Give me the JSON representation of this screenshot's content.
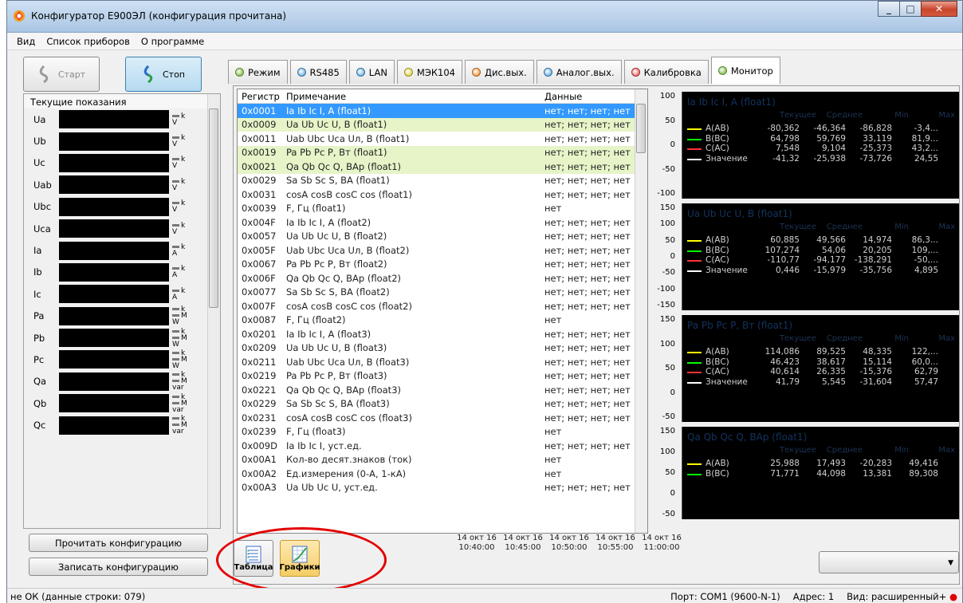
{
  "window": {
    "title": "Конфигуратор Е900ЭЛ (конфигурация прочитана)"
  },
  "menu": [
    "Вид",
    "Список приборов",
    "О программе"
  ],
  "controls": {
    "start_label": "Старт",
    "stop_label": "Стоп"
  },
  "readings": {
    "header": "Текущие показания",
    "rows": [
      {
        "label": "Ua",
        "unit_top": "k",
        "unit_bottom": "V"
      },
      {
        "label": "Ub",
        "unit_top": "k",
        "unit_bottom": "V"
      },
      {
        "label": "Uc",
        "unit_top": "k",
        "unit_bottom": "V"
      },
      {
        "label": "Uab",
        "unit_top": "k",
        "unit_bottom": "V"
      },
      {
        "label": "Ubc",
        "unit_top": "k",
        "unit_bottom": "V"
      },
      {
        "label": "Uca",
        "unit_top": "k",
        "unit_bottom": "V"
      },
      {
        "label": "Ia",
        "unit_top": "k",
        "unit_bottom": "A"
      },
      {
        "label": "Ib",
        "unit_top": "k",
        "unit_bottom": "A"
      },
      {
        "label": "Ic",
        "unit_top": "k",
        "unit_bottom": "A"
      },
      {
        "label": "Pa",
        "unit_top": "k",
        "unit_mid": "M",
        "unit_bottom": "W"
      },
      {
        "label": "Pb",
        "unit_top": "k",
        "unit_mid": "M",
        "unit_bottom": "W"
      },
      {
        "label": "Pc",
        "unit_top": "k",
        "unit_mid": "M",
        "unit_bottom": "W"
      },
      {
        "label": "Qa",
        "unit_top": "k",
        "unit_mid": "M",
        "unit_bottom": "var"
      },
      {
        "label": "Qb",
        "unit_top": "k",
        "unit_mid": "M",
        "unit_bottom": "var"
      },
      {
        "label": "Qc",
        "unit_top": "k",
        "unit_mid": "M",
        "unit_bottom": "var"
      }
    ]
  },
  "buttons": {
    "read_config": "Прочитать конфигурацию",
    "write_config": "Записать конфигурацию"
  },
  "tabs": [
    {
      "label": "Режим",
      "dot": "green"
    },
    {
      "label": "RS485",
      "dot": "blue"
    },
    {
      "label": "LAN",
      "dot": "blue"
    },
    {
      "label": "МЭК104",
      "dot": "yellow"
    },
    {
      "label": "Дис.вых.",
      "dot": "orange"
    },
    {
      "label": "Аналог.вых.",
      "dot": "blue"
    },
    {
      "label": "Калибровка",
      "dot": "red"
    },
    {
      "label": "Монитор",
      "dot": "green",
      "active": true
    }
  ],
  "table": {
    "columns": [
      "Регистр",
      "Примечание",
      "Данные"
    ],
    "rows": [
      {
        "reg": "0x0001",
        "note": "Ia Ib Ic I, A (float1)",
        "data": "нет; нет; нет; нет",
        "state": "sel"
      },
      {
        "reg": "0x0009",
        "note": "Ua Ub Uc U, B (float1)",
        "data": "нет; нет; нет; нет",
        "state": "hl"
      },
      {
        "reg": "0x0011",
        "note": "Uab Ubc Uca Uл, B (float1)",
        "data": "нет; нет; нет; нет",
        "state": ""
      },
      {
        "reg": "0x0019",
        "note": "Pa Pb Pc P, Вт (float1)",
        "data": "нет; нет; нет; нет",
        "state": "hl"
      },
      {
        "reg": "0x0021",
        "note": "Qa Qb Qc Q, BAp (float1)",
        "data": "нет; нет; нет; нет",
        "state": "hl"
      },
      {
        "reg": "0x0029",
        "note": "Sa Sb Sc S, BA (float1)",
        "data": "нет; нет; нет; нет",
        "state": ""
      },
      {
        "reg": "0x0031",
        "note": "cosA cosB cosC cos (float1)",
        "data": "нет; нет; нет; нет",
        "state": ""
      },
      {
        "reg": "0x0039",
        "note": "F, Гц (float1)",
        "data": "нет",
        "state": ""
      },
      {
        "reg": "0x004F",
        "note": "Ia Ib Ic I, A (float2)",
        "data": "нет; нет; нет; нет",
        "state": ""
      },
      {
        "reg": "0x0057",
        "note": "Ua Ub Uc U, B (float2)",
        "data": "нет; нет; нет; нет",
        "state": ""
      },
      {
        "reg": "0x005F",
        "note": "Uab Ubc Uca Uл, B (float2)",
        "data": "нет; нет; нет; нет",
        "state": ""
      },
      {
        "reg": "0x0067",
        "note": "Pa Pb Pc P, Вт (float2)",
        "data": "нет; нет; нет; нет",
        "state": ""
      },
      {
        "reg": "0x006F",
        "note": "Qa Qb Qc Q, BAp (float2)",
        "data": "нет; нет; нет; нет",
        "state": ""
      },
      {
        "reg": "0x0077",
        "note": "Sa Sb Sc S, BA (float2)",
        "data": "нет; нет; нет; нет",
        "state": ""
      },
      {
        "reg": "0x007F",
        "note": "cosA cosB cosC cos (float2)",
        "data": "нет; нет; нет; нет",
        "state": ""
      },
      {
        "reg": "0x0087",
        "note": "F, Гц (float2)",
        "data": "нет",
        "state": ""
      },
      {
        "reg": "0x0201",
        "note": "Ia Ib Ic I, A (float3)",
        "data": "нет; нет; нет; нет",
        "state": ""
      },
      {
        "reg": "0x0209",
        "note": "Ua Ub Uc U, B (float3)",
        "data": "нет; нет; нет; нет",
        "state": ""
      },
      {
        "reg": "0x0211",
        "note": "Uab Ubc Uca Uл, B (float3)",
        "data": "нет; нет; нет; нет",
        "state": ""
      },
      {
        "reg": "0x0219",
        "note": "Pa Pb Pc P, Вт (float3)",
        "data": "нет; нет; нет; нет",
        "state": ""
      },
      {
        "reg": "0x0221",
        "note": "Qa Qb Qc Q, BAp (float3)",
        "data": "нет; нет; нет; нет",
        "state": ""
      },
      {
        "reg": "0x0229",
        "note": "Sa Sb Sc S, BA (float3)",
        "data": "нет; нет; нет; нет",
        "state": ""
      },
      {
        "reg": "0x0231",
        "note": "cosA cosB cosC cos (float3)",
        "data": "нет; нет; нет; нет",
        "state": ""
      },
      {
        "reg": "0x0239",
        "note": "F, Гц (float3)",
        "data": "нет",
        "state": ""
      },
      {
        "reg": "0x009D",
        "note": "Ia Ib Ic I, уст.ед.",
        "data": "нет; нет; нет; нет",
        "state": ""
      },
      {
        "reg": "0x00A1",
        "note": "Кол-во десят.знаков (ток)",
        "data": "нет",
        "state": ""
      },
      {
        "reg": "0x00A2",
        "note": "Ед.измерения (0-A, 1-кA)",
        "data": "нет",
        "state": ""
      },
      {
        "reg": "0x00A3",
        "note": "Ua Ub Uc U, уст.ед.",
        "data": "нет; нет; нет; нет",
        "state": ""
      }
    ]
  },
  "graphs": {
    "column_headers": [
      "Текущее",
      "Среднее",
      "Min",
      "Max"
    ],
    "panels": [
      {
        "title": "Ia Ib Ic I, A (float1)",
        "axis": [
          "100",
          "50",
          "0",
          "-50",
          "-100"
        ],
        "rows": [
          {
            "name": "A(AB)",
            "color": "#ffff00",
            "values": [
              "-80,362",
              "-46,364",
              "-86,828",
              "-3,4..."
            ]
          },
          {
            "name": "B(BC)",
            "color": "#00ff00",
            "values": [
              "64,798",
              "59,769",
              "33,119",
              "81,9..."
            ]
          },
          {
            "name": "C(AC)",
            "color": "#ff3333",
            "values": [
              "7,548",
              "9,104",
              "-25,373",
              "43,2..."
            ]
          },
          {
            "name": "Значение",
            "color": "#ffffff",
            "values": [
              "-41,32",
              "-25,938",
              "-73,726",
              "24,55"
            ]
          }
        ]
      },
      {
        "title": "Ua Ub Uc U, B (float1)",
        "axis": [
          "150",
          "100",
          "50",
          "0",
          "-50",
          "-100",
          "-150"
        ],
        "rows": [
          {
            "name": "A(AB)",
            "color": "#ffff00",
            "values": [
              "60,885",
              "49,566",
              "14,974",
              "86,3..."
            ]
          },
          {
            "name": "B(BC)",
            "color": "#00ff00",
            "values": [
              "107,274",
              "54,06",
              "20,205",
              "109,..."
            ]
          },
          {
            "name": "C(AC)",
            "color": "#ff3333",
            "values": [
              "-110,77",
              "-94,177",
              "-138,291",
              "-50,..."
            ]
          },
          {
            "name": "Значение",
            "color": "#ffffff",
            "values": [
              "0,446",
              "-15,979",
              "-35,756",
              "4,895"
            ]
          }
        ]
      },
      {
        "title": "Pa Pb Pc P, Вт (float1)",
        "axis": [
          "150",
          "100",
          "50",
          "0",
          "-50"
        ],
        "rows": [
          {
            "name": "A(AB)",
            "color": "#ffff00",
            "values": [
              "114,086",
              "89,525",
              "48,335",
              "122,..."
            ]
          },
          {
            "name": "B(BC)",
            "color": "#00ff00",
            "values": [
              "46,423",
              "38,617",
              "15,114",
              "60,0..."
            ]
          },
          {
            "name": "C(AC)",
            "color": "#ff3333",
            "values": [
              "40,614",
              "26,335",
              "-15,376",
              "62,79"
            ]
          },
          {
            "name": "Значение",
            "color": "#ffffff",
            "values": [
              "41,79",
              "5,545",
              "-31,604",
              "57,47"
            ]
          }
        ]
      },
      {
        "title": "Qa Qb Qc Q, BAp (float1)",
        "axis": [
          "150",
          "100",
          "50",
          "0",
          "-50"
        ],
        "rows": [
          {
            "name": "A(AB)",
            "color": "#ffff00",
            "values": [
              "25,988",
              "17,493",
              "-20,283",
              "49,416"
            ]
          },
          {
            "name": "B(BC)",
            "color": "#00ff00",
            "values": [
              "71,771",
              "44,098",
              "13,381",
              "89,308"
            ]
          }
        ]
      }
    ],
    "x_labels": [
      {
        "date": "14 окт 16",
        "time": "10:40:00"
      },
      {
        "date": "14 окт 16",
        "time": "10:45:00"
      },
      {
        "date": "14 окт 16",
        "time": "10:50:00"
      },
      {
        "date": "14 окт 16",
        "time": "10:55:00"
      },
      {
        "date": "14 окт 16",
        "time": "11:00:00"
      }
    ]
  },
  "view_toggle": {
    "table_label": "Таблица",
    "graphs_label": "Графики"
  },
  "status": {
    "left": "не ОК (данные строки: 079)",
    "port": "Порт: COM1 (9600-N-1)",
    "address": "Адрес: 1",
    "view": "Вид: расширенный+"
  }
}
